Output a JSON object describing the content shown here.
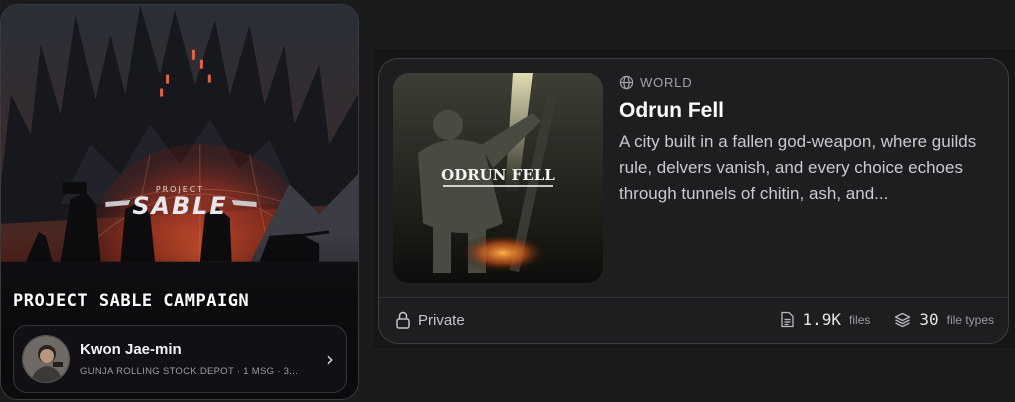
{
  "campaign": {
    "title": "PROJECT SABLE CAMPAIGN",
    "art_logo_small": "PROJECT",
    "art_logo_big": "SABLE",
    "session": {
      "name": "Kwon Jae-min",
      "subtitle": "GUNJA ROLLING STOCK DEPOT · 1 MSG · 3..."
    }
  },
  "world": {
    "type_label": "WORLD",
    "name": "Odrun Fell",
    "cover_text": "ODRUN FELL",
    "description": "A city built in a fallen god-weapon, where guilds rule, delvers vanish, and every choice echoes through tunnels of chitin, ash, and...",
    "privacy": "Private",
    "files_count": "1.9K",
    "files_label": "files",
    "types_count": "30",
    "types_label": "file types"
  },
  "icons": {
    "world": "globe-icon",
    "privacy": "lock-icon",
    "files": "file-icon",
    "types": "layers-icon",
    "open": "chevron-right-icon"
  },
  "colors": {
    "background": "#1b1b1d",
    "card": "#1e1e21",
    "accent_red": "#c2412a"
  }
}
